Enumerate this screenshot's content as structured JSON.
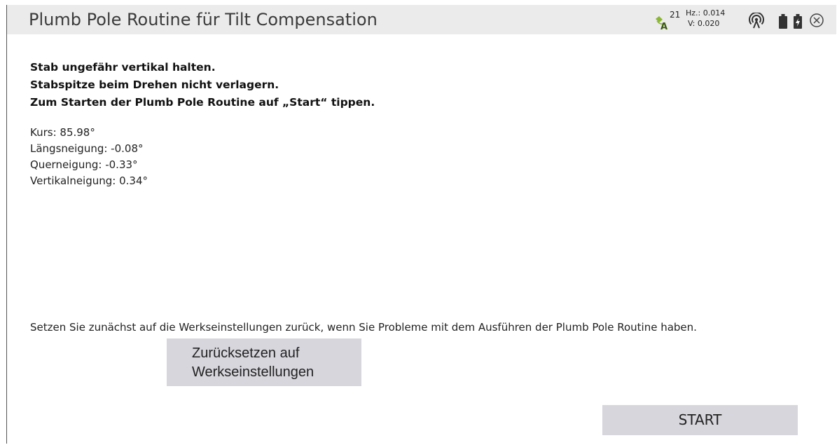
{
  "window": {
    "title": "Plumb Pole Routine für Tilt Compensation"
  },
  "status": {
    "satellites": "21",
    "hz_precision": "Hz.: 0.014",
    "v_precision": "V: 0.020",
    "icons": [
      "satellite-icon",
      "radio-icon",
      "battery-icon",
      "battery-charging-icon",
      "close-icon"
    ]
  },
  "instructions": {
    "line1": "Stab ungefähr vertikal halten.",
    "line2": "Stabspitze beim Drehen nicht verlagern.",
    "line3": "Zum Starten der Plumb Pole Routine auf „Start“ tippen."
  },
  "readouts": {
    "heading": "Kurs: 85.98°",
    "pitch": "Längsneigung: -0.08°",
    "roll": "Querneigung: -0.33°",
    "vertical_tilt": "Vertikalneigung: 0.34°"
  },
  "reset": {
    "note": "Setzen Sie zunächst auf die Werkseinstellungen zurück, wenn Sie Probleme mit dem Ausführen der Plumb Pole Routine haben.",
    "button_line1": "Zurücksetzen auf",
    "button_line2": "Werkseinstellungen"
  },
  "start": {
    "label": "START"
  },
  "colors": {
    "titlebar": "#ebebeb",
    "button": "#d6d6dc",
    "satellite_green": "#8ab833",
    "satellite_dark": "#3a5a10"
  }
}
